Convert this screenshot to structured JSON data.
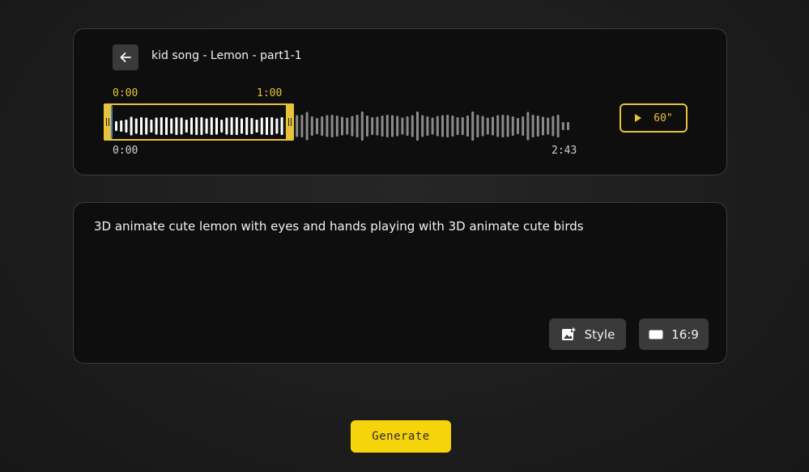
{
  "audio": {
    "track_title": "kid song - Lemon - part1-1",
    "selection_start": "0:00",
    "selection_end": "1:00",
    "track_start": "0:00",
    "track_end": "2:43",
    "play_duration_label": "60\"",
    "selection_fraction": 0.368,
    "icons": {
      "back": "arrow-left-icon",
      "play": "play-icon"
    }
  },
  "prompt": {
    "text": "3D animate cute lemon with eyes and hands playing with 3D animate cute birds",
    "style_label": "Style",
    "ratio_label": "16:9",
    "icons": {
      "style": "image-add-icon",
      "ratio": "aspect-ratio-icon"
    }
  },
  "generate": {
    "label": "Generate"
  },
  "colors": {
    "accent": "#e8c33a",
    "button_yellow": "#f6d40b",
    "card_bg": "#0e0e0e",
    "chip_bg": "#3a3a3a"
  }
}
